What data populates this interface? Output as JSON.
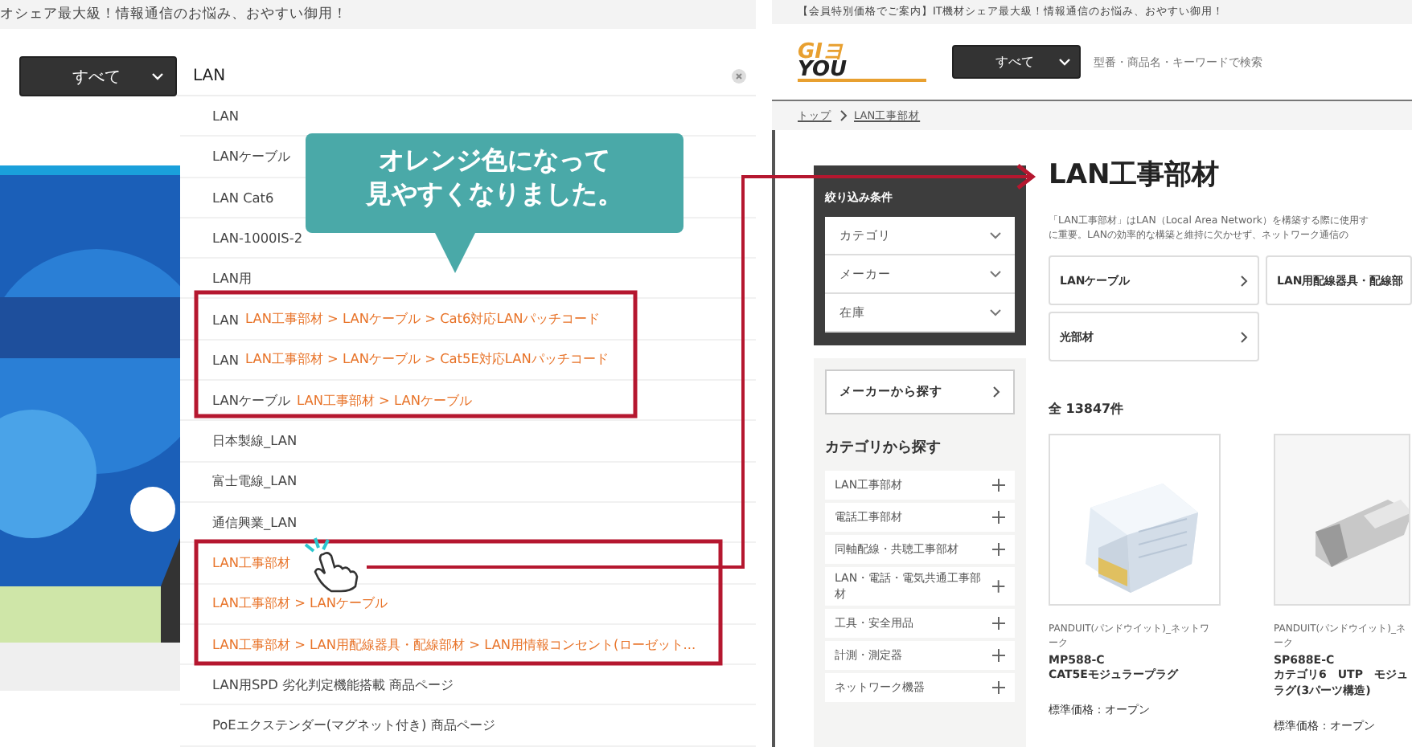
{
  "left_page": {
    "banner": "オシェア最大級！情報通信のお悩み、おやすい御用！",
    "search": {
      "category": "すべて",
      "value": "LAN"
    },
    "suggestions": [
      {
        "kind": "keyword",
        "text": "LAN"
      },
      {
        "kind": "keyword",
        "text": "LANケーブル"
      },
      {
        "kind": "keyword",
        "text": "LAN Cat6"
      },
      {
        "kind": "keyword",
        "text": "LAN-1000IS-2"
      },
      {
        "kind": "keyword",
        "text": "LAN用"
      },
      {
        "kind": "category",
        "term": "LAN",
        "path": "LAN工事部材 > LANケーブル > Cat6対応LANパッチコード"
      },
      {
        "kind": "category",
        "term": "LAN",
        "path": "LAN工事部材 > LANケーブル > Cat5E対応LANパッチコード"
      },
      {
        "kind": "category",
        "term": "LANケーブル",
        "path": "LAN工事部材 > LANケーブル"
      },
      {
        "kind": "keyword",
        "text": "日本製線_LAN"
      },
      {
        "kind": "keyword",
        "text": "富士電線_LAN"
      },
      {
        "kind": "keyword",
        "text": "通信興業_LAN"
      },
      {
        "kind": "category",
        "path": "LAN工事部材"
      },
      {
        "kind": "category",
        "path": "LAN工事部材 > LANケーブル"
      },
      {
        "kind": "category",
        "path": "LAN工事部材 > LAN用配線器具・配線部材 > LAN用情報コンセント(ローゼット..."
      },
      {
        "kind": "keyword",
        "text": "LAN用SPD 劣化判定機能搭載 商品ページ"
      },
      {
        "kind": "keyword",
        "text": "PoEエクステンダー(マグネット付き) 商品ページ"
      }
    ]
  },
  "callout": {
    "lines": [
      "オレンジ色になって",
      "見やすくなりました。"
    ]
  },
  "right_page": {
    "banner": "【会員特別価格でご案内】IT機材シェア最大級！情報通信のお悩み、おやすい御用！",
    "logo": [
      "GIヨ",
      "YOU"
    ],
    "search": {
      "category": "すべて",
      "placeholder": "型番・商品名・キーワードで検索"
    },
    "breadcrumb": [
      "トップ",
      "LAN工事部材"
    ],
    "filter": {
      "title": "絞り込み条件",
      "items": [
        "カテゴリ",
        "メーカー",
        "在庫"
      ]
    },
    "maker_button": "メーカーから探す",
    "category_heading": "カテゴリから探す",
    "categories": [
      "LAN工事部材",
      "電話工事部材",
      "同軸配線・共聴工事部材",
      "LAN・電話・電気共通工事部材",
      "工具・安全用品",
      "計測・測定器",
      "ネットワーク機器"
    ],
    "title": "LAN工事部材",
    "description": [
      "「LAN工事部材」はLAN（Local Area Network）を構築する際に使用す",
      "に重要。LANの効率的な構築と維持に欠かせず、ネットワーク通信の"
    ],
    "subcategories": [
      {
        "label": "LANケーブル",
        "arrow": true
      },
      {
        "label": "LAN用配線器具・配線部",
        "arrow": false
      },
      {
        "label": "光部材",
        "arrow": true
      }
    ],
    "count": "全 13847件",
    "products": [
      {
        "maker": [
          "PANDUIT(パンドウイット)_ネットワ",
          "ーク"
        ],
        "model": "MP588-C",
        "name": [
          "CAT5Eモジュラープラグ"
        ],
        "price": "標準価格：オープン"
      },
      {
        "maker": [
          "PANDUIT(パンドウイット)_ネ",
          "ーク"
        ],
        "model": "SP688E-C",
        "name": [
          "カテゴリ6　UTP　モジュ",
          "ラグ(3パーツ構造)"
        ],
        "price": "標準価格：オープン"
      }
    ]
  }
}
